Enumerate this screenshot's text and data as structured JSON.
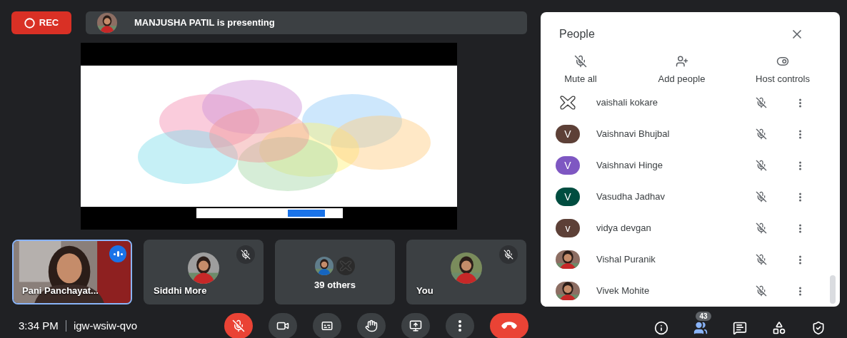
{
  "top_bar": {
    "recording": {
      "label": "REC",
      "on": true
    },
    "presenter": {
      "text": "MANJUSHA PATIL is presenting"
    }
  },
  "tiles": [
    {
      "kind": "video",
      "name": "Pani Panchayat...",
      "speaking": true,
      "muted": false
    },
    {
      "kind": "avatar",
      "name": "Siddhi More",
      "speaking": false,
      "muted": true
    },
    {
      "kind": "group",
      "name": "39 others",
      "speaking": false,
      "muted": false
    },
    {
      "kind": "avatar",
      "name": "You",
      "speaking": false,
      "muted": true
    }
  ],
  "people_panel": {
    "title": "People",
    "actions": [
      {
        "kind": "mute-all",
        "label": "Mute all"
      },
      {
        "kind": "add-people",
        "label": "Add people"
      },
      {
        "kind": "host-controls",
        "label": "Host controls"
      }
    ],
    "participants": [
      {
        "name": "vaishali kokare",
        "avatar": {
          "kind": "logo"
        },
        "muted": true
      },
      {
        "name": "Vaishnavi Bhujbal",
        "avatar": {
          "kind": "letter",
          "letter": "V",
          "color": "#5d4037"
        },
        "muted": true
      },
      {
        "name": "Vaishnavi Hinge",
        "avatar": {
          "kind": "letter",
          "letter": "V",
          "color": "#7e57c2"
        },
        "muted": true
      },
      {
        "name": "Vasudha Jadhav",
        "avatar": {
          "kind": "letter",
          "letter": "V",
          "color": "#004d40"
        },
        "muted": true
      },
      {
        "name": "vidya devgan",
        "avatar": {
          "kind": "letter",
          "letter": "v",
          "color": "#5d4037"
        },
        "muted": true
      },
      {
        "name": "Vishal Puranik",
        "muted": true
      },
      {
        "name": "Vivek Mohite",
        "muted": true
      }
    ]
  },
  "bottom_bar": {
    "time": "3:34 PM",
    "meeting_code": "igw-wsiw-qvo",
    "controls": [
      {
        "kind": "mic",
        "on": false
      },
      {
        "kind": "camera",
        "on": true
      },
      {
        "kind": "captions"
      },
      {
        "kind": "raise-hand"
      },
      {
        "kind": "present"
      },
      {
        "kind": "more"
      },
      {
        "kind": "end-call"
      }
    ],
    "side_buttons": [
      {
        "kind": "info",
        "selected": false
      },
      {
        "kind": "people",
        "selected": true,
        "badge": "43"
      },
      {
        "kind": "chat",
        "selected": false
      },
      {
        "kind": "activities",
        "selected": false
      },
      {
        "kind": "host-safety",
        "selected": false
      }
    ]
  }
}
